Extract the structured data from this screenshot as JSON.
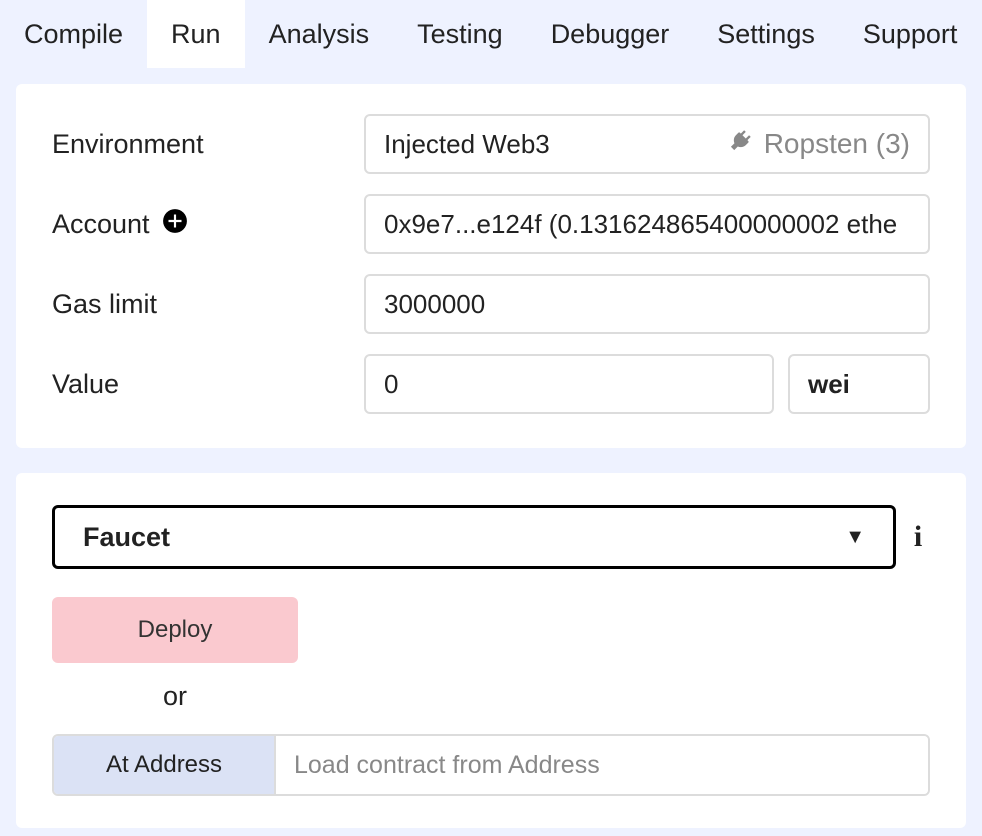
{
  "tabs": {
    "items": [
      "Compile",
      "Run",
      "Analysis",
      "Testing",
      "Debugger",
      "Settings",
      "Support"
    ],
    "active_index": 1
  },
  "run": {
    "environment": {
      "label": "Environment",
      "selected": "Injected Web3",
      "network": "Ropsten (3)"
    },
    "account": {
      "label": "Account",
      "selected": "0x9e7...e124f (0.131624865400000002 ethe"
    },
    "gas_limit": {
      "label": "Gas limit",
      "value": "3000000"
    },
    "value": {
      "label": "Value",
      "amount": "0",
      "unit": "wei"
    }
  },
  "deploy": {
    "contract_selected": "Faucet",
    "deploy_label": "Deploy",
    "or_label": "or",
    "at_address_label": "At Address",
    "at_address_placeholder": "Load contract from Address"
  }
}
